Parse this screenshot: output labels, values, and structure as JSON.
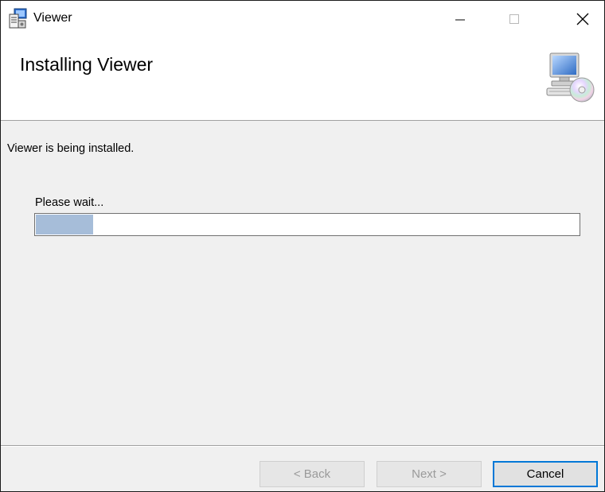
{
  "window": {
    "title": "Viewer",
    "icon": "installer-icon",
    "controls": {
      "minimize": "minimize-icon",
      "maximize": "maximize-icon",
      "close": "close-icon"
    }
  },
  "header": {
    "title": "Installing Viewer",
    "icon": "computer-cd-icon"
  },
  "body": {
    "status_text": "Viewer is being installed.",
    "wait_text": "Please wait...",
    "progress_fraction": 0.105
  },
  "footer": {
    "back_label": "< Back",
    "next_label": "Next >",
    "cancel_label": "Cancel",
    "back_enabled": false,
    "next_enabled": false
  },
  "colors": {
    "accent": "#0078d7",
    "progress_fill": "#a6bdd9",
    "dialog_bg": "#f0f0f0"
  }
}
